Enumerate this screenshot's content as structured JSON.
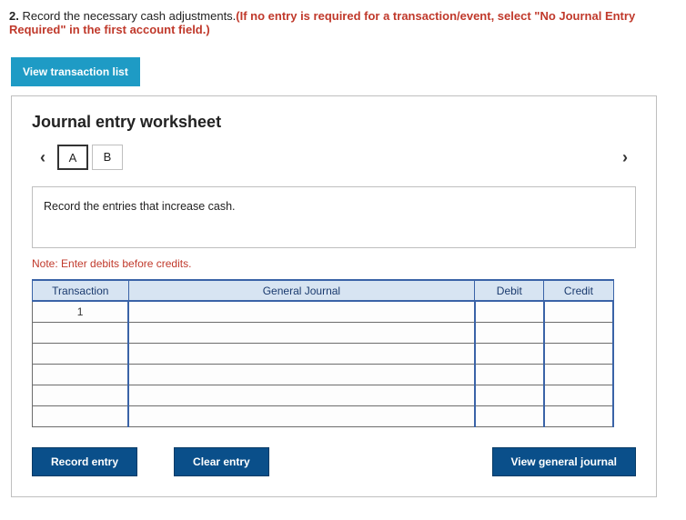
{
  "question": {
    "number": "2.",
    "text": " Record the necessary cash adjustments.",
    "hint": "(If no entry is required for a transaction/event, select \"No Journal Entry Required\" in the first account field.)"
  },
  "view_transaction_list": "View transaction list",
  "panel": {
    "title": "Journal entry worksheet",
    "tabs": [
      "A",
      "B"
    ],
    "instruction": "Record the entries that increase cash.",
    "note": "Note: Enter debits before credits.",
    "columns": {
      "trx": "Transaction",
      "gj": "General Journal",
      "debit": "Debit",
      "credit": "Credit"
    },
    "rows": [
      {
        "trx": "1",
        "gj": "",
        "debit": "",
        "credit": ""
      },
      {
        "trx": "",
        "gj": "",
        "debit": "",
        "credit": ""
      },
      {
        "trx": "",
        "gj": "",
        "debit": "",
        "credit": ""
      },
      {
        "trx": "",
        "gj": "",
        "debit": "",
        "credit": ""
      },
      {
        "trx": "",
        "gj": "",
        "debit": "",
        "credit": ""
      },
      {
        "trx": "",
        "gj": "",
        "debit": "",
        "credit": ""
      }
    ],
    "buttons": {
      "record": "Record entry",
      "clear": "Clear entry",
      "view": "View general journal"
    }
  }
}
